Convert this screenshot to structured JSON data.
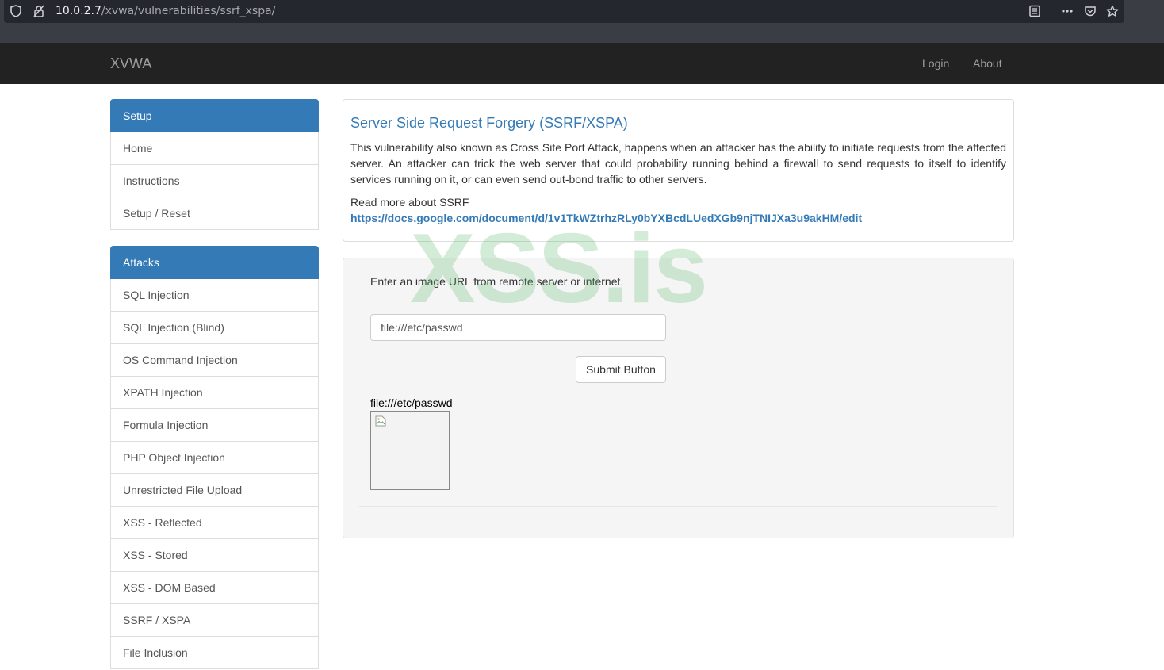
{
  "browser": {
    "url_host": "10.0.2.7",
    "url_path": "/xvwa/vulnerabilities/ssrf_xspa/",
    "icons": [
      "shield-icon",
      "insecure-lock-icon",
      "reader-view-icon",
      "more-icon",
      "pocket-icon",
      "bookmark-star-icon"
    ]
  },
  "navbar": {
    "brand": "XVWA",
    "links": [
      "Login",
      "About"
    ]
  },
  "sidebar": {
    "setup": {
      "header": "Setup",
      "items": [
        "Home",
        "Instructions",
        "Setup / Reset"
      ]
    },
    "attacks": {
      "header": "Attacks",
      "items": [
        "SQL Injection",
        "SQL Injection (Blind)",
        "OS Command Injection",
        "XPATH Injection",
        "Formula Injection",
        "PHP Object Injection",
        "Unrestricted File Upload",
        "XSS - Reflected",
        "XSS - Stored",
        "XSS - DOM Based",
        "SSRF / XSPA",
        "File Inclusion"
      ]
    }
  },
  "info": {
    "title": "Server Side Request Forgery (SSRF/XSPA)",
    "description": "This vulnerability also known as Cross Site Port Attack, happens when an attacker has the ability to initiate requests from the affected server. An attacker can trick the web server that could probability running behind a firewall to send requests to itself to identify services running on it, or can even send out-bond traffic to other servers.",
    "read_more": "Read more about SSRF",
    "link": "https://docs.google.com/document/d/1v1TkWZtrhzRLy0bYXBcdLUedXGb9njTNIJXa3u9akHM/edit"
  },
  "form": {
    "label": "Enter an image URL from remote server or internet.",
    "input_value": "file:///etc/passwd",
    "submit_label": "Submit Button",
    "result_label": "file:///etc/passwd"
  },
  "watermark": "XSS.is"
}
